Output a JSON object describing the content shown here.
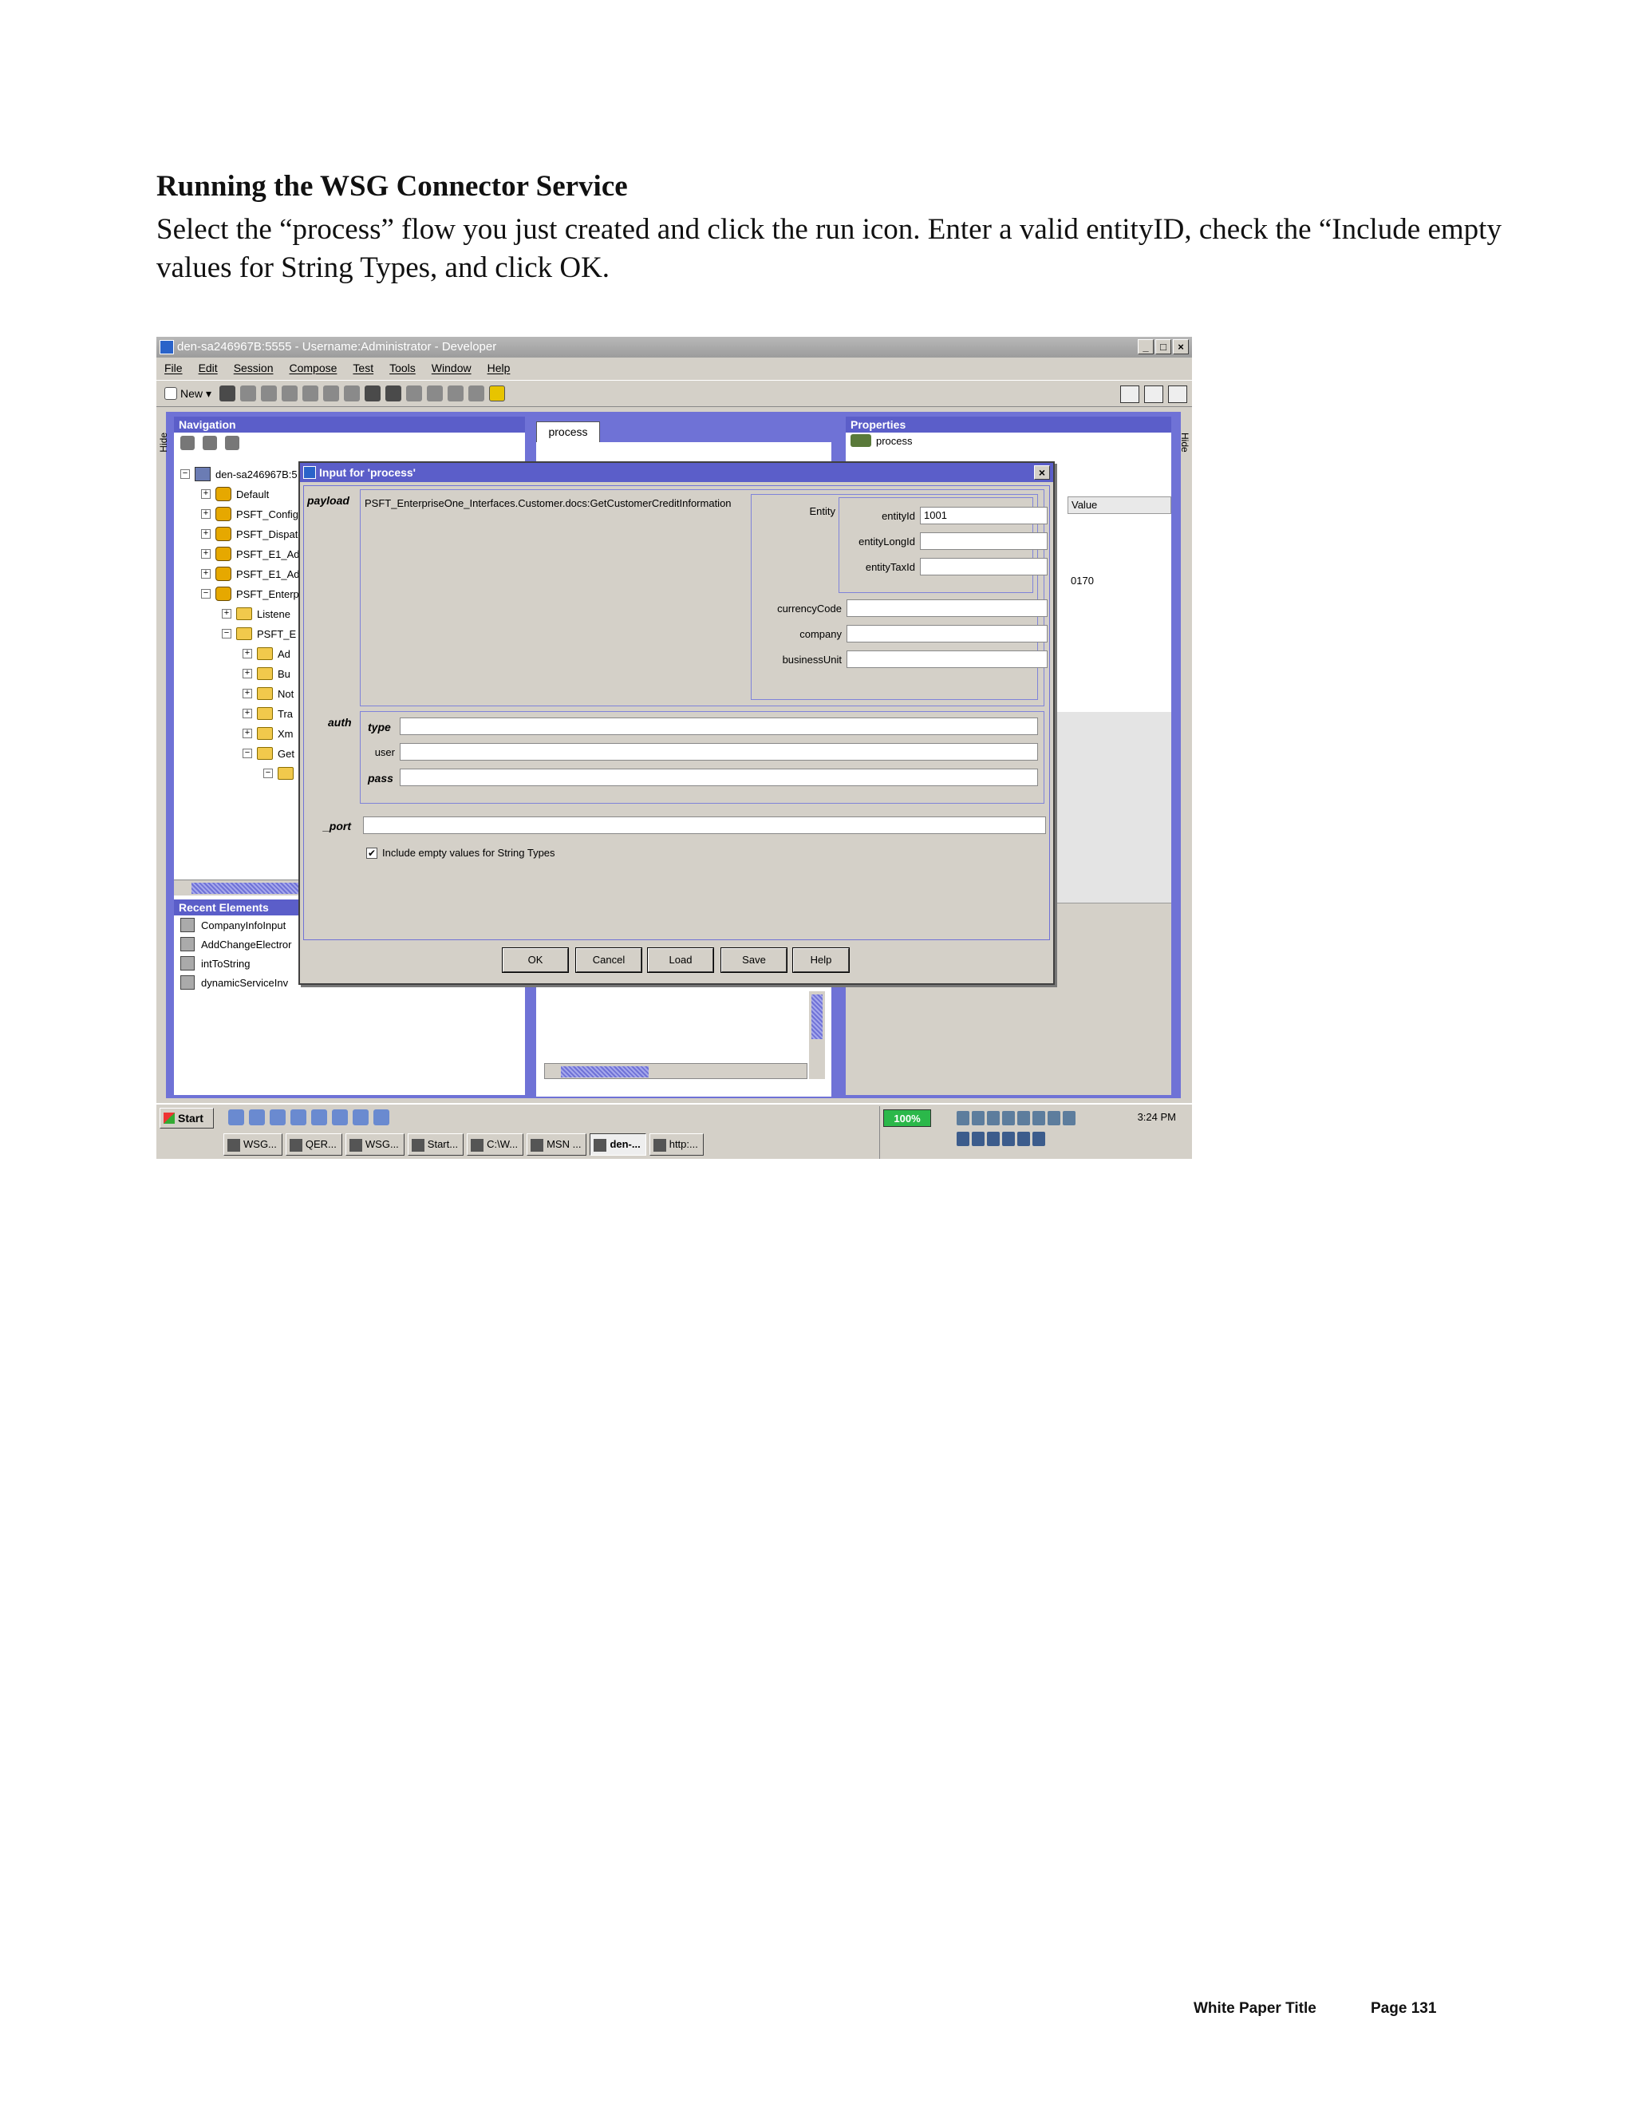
{
  "heading": "Running the WSG Connector Service",
  "intro": "Select the “process” flow you just created and click the run icon. Enter a valid entityID, check the “Include empty values for String Types, and click OK.",
  "screenshot": {
    "window_title": "den-sa246967B:5555 - Username:Administrator - Developer",
    "window_buttons": [
      "_",
      "□",
      "×"
    ],
    "menu": [
      "File",
      "Edit",
      "Session",
      "Compose",
      "Test",
      "Tools",
      "Window",
      "Help"
    ],
    "toolbar_new": "New",
    "hide_left": "Hide",
    "hide_right": "Hide",
    "navigation": {
      "header": "Navigation",
      "tree": [
        {
          "label": "den-sa246967B:5",
          "depth": 0,
          "toggle": "−",
          "kind": "server"
        },
        {
          "label": "Default",
          "depth": 1,
          "toggle": "+",
          "kind": "package"
        },
        {
          "label": "PSFT_Configu",
          "depth": 1,
          "toggle": "+",
          "kind": "package"
        },
        {
          "label": "PSFT_Dispatc",
          "depth": 1,
          "toggle": "+",
          "kind": "package"
        },
        {
          "label": "PSFT_E1_Ad",
          "depth": 1,
          "toggle": "+",
          "kind": "package"
        },
        {
          "label": "PSFT_E1_Ad",
          "depth": 1,
          "toggle": "+",
          "kind": "package"
        },
        {
          "label": "PSFT_Enterpri",
          "depth": 1,
          "toggle": "−",
          "kind": "package"
        },
        {
          "label": "Listene",
          "depth": 2,
          "toggle": "+",
          "kind": "folder"
        },
        {
          "label": "PSFT_E",
          "depth": 2,
          "toggle": "−",
          "kind": "folder"
        },
        {
          "label": "Ad",
          "depth": 3,
          "toggle": "+",
          "kind": "folder"
        },
        {
          "label": "Bu",
          "depth": 3,
          "toggle": "+",
          "kind": "folder"
        },
        {
          "label": "Not",
          "depth": 3,
          "toggle": "+",
          "kind": "folder"
        },
        {
          "label": "Tra",
          "depth": 3,
          "toggle": "+",
          "kind": "folder"
        },
        {
          "label": "Xm",
          "depth": 3,
          "toggle": "+",
          "kind": "folder"
        },
        {
          "label": "Get",
          "depth": 3,
          "toggle": "−",
          "kind": "folder"
        },
        {
          "label": "",
          "depth": 4,
          "toggle": "−",
          "kind": "folder"
        }
      ]
    },
    "recent": {
      "header": "Recent Elements",
      "items": [
        "CompanyInfoInput",
        "AddChangeElectror",
        "intToString",
        "dynamicServiceInv"
      ]
    },
    "editor_tab": "process",
    "properties": {
      "header": "Properties",
      "item": "process",
      "value_header": "Value",
      "value": "0170"
    },
    "dialog": {
      "title": "Input for 'process'",
      "close": "×",
      "payload_label": "payload",
      "payload_type": "PSFT_EnterpriseOne_Interfaces.Customer.docs:GetCustomerCreditInformation",
      "entity_label": "Entity",
      "fields": {
        "entityId": {
          "label": "entityId",
          "value": "1001"
        },
        "entityLongId": {
          "label": "entityLongId",
          "value": ""
        },
        "entityTaxId": {
          "label": "entityTaxId",
          "value": ""
        },
        "currencyCode": {
          "label": "currencyCode",
          "value": ""
        },
        "company": {
          "label": "company",
          "value": ""
        },
        "businessUnit": {
          "label": "businessUnit",
          "value": ""
        },
        "type": {
          "label": "type",
          "value": ""
        },
        "user": {
          "label": "user",
          "value": ""
        },
        "pass": {
          "label": "pass",
          "value": ""
        },
        "port": {
          "label": "_port",
          "value": ""
        }
      },
      "auth_label": "auth",
      "include_empty_label": "Include empty values for String Types",
      "include_empty_checked": true,
      "check_mark": "✔",
      "buttons": {
        "ok": "OK",
        "cancel": "Cancel",
        "load": "Load",
        "save": "Save",
        "help": "Help"
      }
    },
    "taskbar": {
      "start": "Start",
      "tasks": [
        "WSG...",
        "QER...",
        "WSG...",
        "Start...",
        "C:\\W...",
        "MSN ...",
        "den-...",
        "http:..."
      ],
      "active_task_index": 6,
      "battery": "100%",
      "clock": "3:24 PM"
    }
  },
  "footer": {
    "title": "White Paper Title",
    "page": "Page 131"
  }
}
